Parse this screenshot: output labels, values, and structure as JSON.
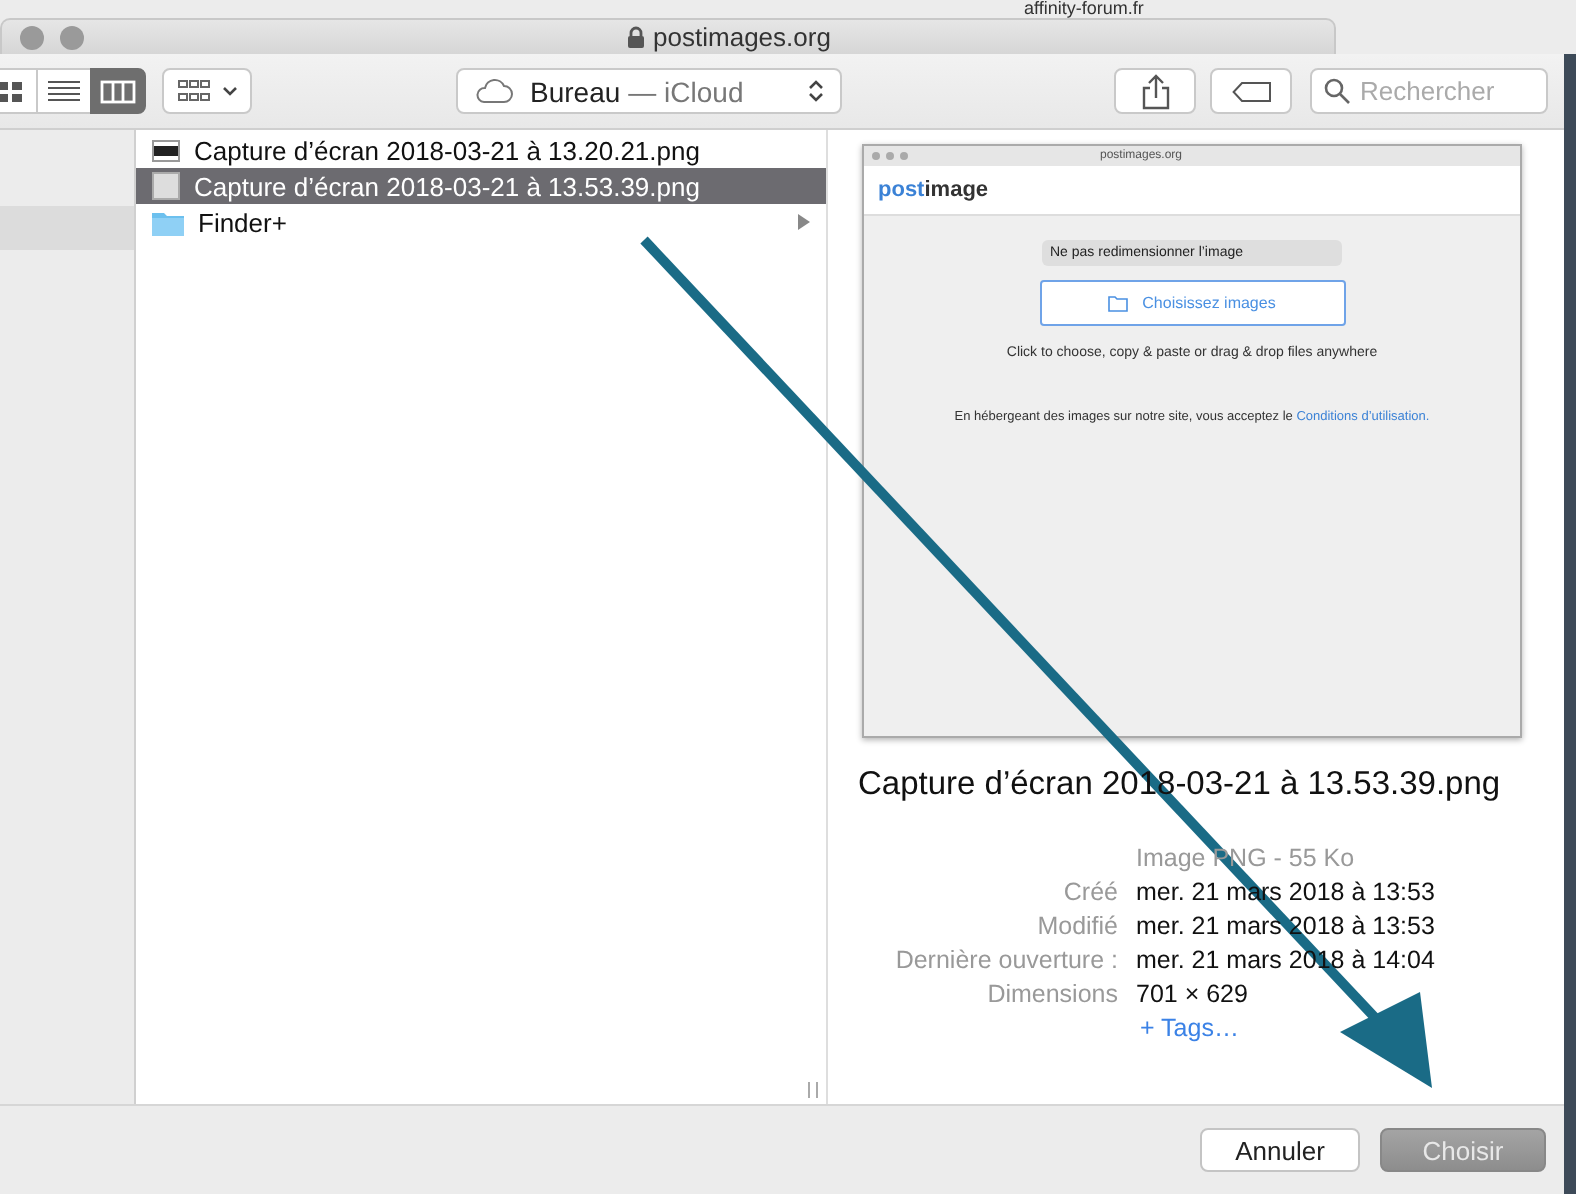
{
  "background_page": {
    "site": "affinity-forum.fr"
  },
  "window": {
    "title": "postimages.org"
  },
  "toolbar": {
    "view_modes": [
      {
        "kind": "icons",
        "selected": false
      },
      {
        "kind": "list",
        "selected": false
      },
      {
        "kind": "columns",
        "selected": true
      }
    ],
    "location": {
      "folder": "Bureau",
      "separator": "—",
      "service": "iCloud"
    },
    "search": {
      "placeholder": "Rechercher"
    }
  },
  "files": [
    {
      "name": "Capture d’écran 2018-03-21 à 13.20.21.png",
      "kind": "image-dark",
      "selected": false,
      "has_children": false
    },
    {
      "name": "Capture d’écran 2018-03-21 à 13.53.39.png",
      "kind": "image-light",
      "selected": true,
      "has_children": false
    },
    {
      "name": "Finder+",
      "kind": "folder",
      "selected": false,
      "has_children": true
    }
  ],
  "preview": {
    "thumbnail": {
      "title": "postimages.org",
      "logo_first": "post",
      "logo_second": "image",
      "resize_select": "Ne pas redimensionner l’image",
      "choose_button": "Choisissez images",
      "hint": "Click to choose, copy & paste or drag & drop files anywhere",
      "terms": "En hébergeant des images sur notre site, vous acceptez le",
      "terms_link": "Conditions d’utilisation."
    },
    "filename": "Capture d’écran 2018-03-21 à 13.53.39.png",
    "file_kind": "Image PNG - 55 Ko",
    "info": [
      {
        "label": "Créé",
        "value": "mer. 21 mars 2018 à 13:53"
      },
      {
        "label": "Modifié",
        "value": "mer. 21 mars 2018 à 13:53"
      },
      {
        "label": "Dernière ouverture :",
        "value": "mer. 21 mars 2018 à 14:04"
      },
      {
        "label": "Dimensions",
        "value": "701 × 629"
      }
    ],
    "tags_link": "+ Tags…"
  },
  "buttons": [
    {
      "label": "Annuler",
      "kind": "cancel",
      "disabled": false
    },
    {
      "label": "Choisir",
      "kind": "default",
      "disabled": true
    }
  ]
}
